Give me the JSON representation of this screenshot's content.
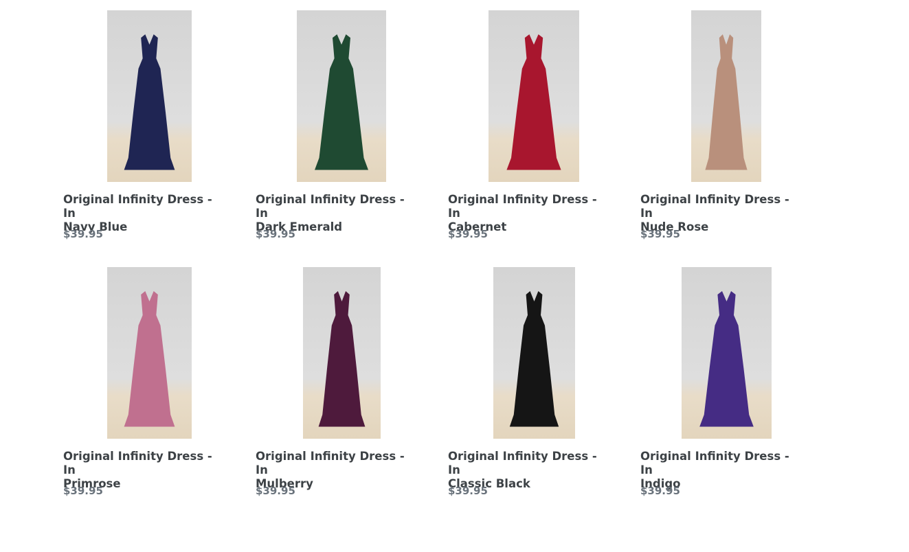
{
  "products": [
    {
      "title": "Original Infinity Dress - In\nNavy Blue",
      "price": "$39.95",
      "color": "#1f2553"
    },
    {
      "title": "Original Infinity Dress - In\nDark Emerald",
      "price": "$39.95",
      "color": "#1f4a32"
    },
    {
      "title": "Original Infinity Dress - In\nCabernet",
      "price": "$39.95",
      "color": "#a8162e"
    },
    {
      "title": "Original Infinity Dress - In\nNude Rose",
      "price": "$39.95",
      "color": "#b9907c"
    },
    {
      "title": "Original Infinity Dress - In\nPrimrose",
      "price": "$39.95",
      "color": "#c0708f"
    },
    {
      "title": "Original Infinity Dress - In\nMulberry",
      "price": "$39.95",
      "color": "#4e1a3c"
    },
    {
      "title": "Original Infinity Dress - In\nClassic Black",
      "price": "$39.95",
      "color": "#151515"
    },
    {
      "title": "Original Infinity Dress - In\nIndigo",
      "price": "$39.95",
      "color": "#452c84"
    }
  ]
}
